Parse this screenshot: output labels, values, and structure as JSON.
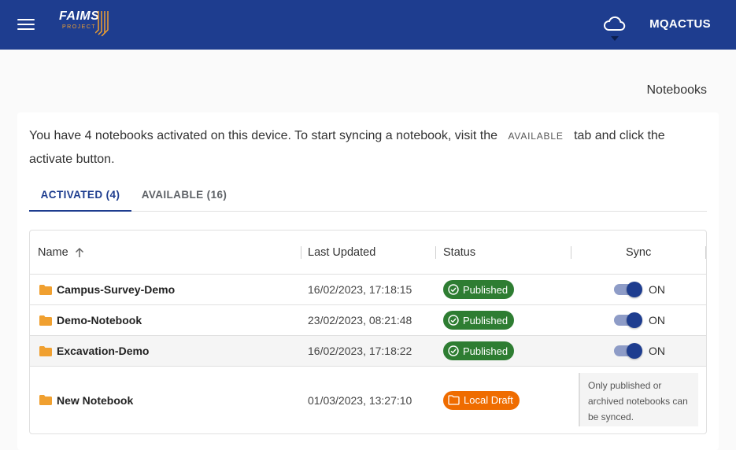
{
  "appbar": {
    "logo_text": "FAIMS",
    "logo_sub": "PROJECT",
    "user": "MQACTUS",
    "colors": {
      "bar": "#1e3d8f",
      "accent": "#f0a030"
    }
  },
  "page": {
    "title": "Notebooks"
  },
  "intro": {
    "before": "You have 4 notebooks activated on this device. To start syncing a notebook, visit the",
    "code": "AVAILABLE",
    "after": "tab and click the activate button."
  },
  "tabs": [
    {
      "label": "ACTIVATED (4)",
      "selected": true
    },
    {
      "label": "AVAILABLE (16)",
      "selected": false
    }
  ],
  "table": {
    "columns": {
      "name": "Name",
      "last_updated": "Last Updated",
      "status": "Status",
      "sync": "Sync"
    },
    "rows": [
      {
        "name": "Campus-Survey-Demo",
        "last_updated": "16/02/2023, 17:18:15",
        "status": "Published",
        "sync": "ON"
      },
      {
        "name": "Demo-Notebook",
        "last_updated": "23/02/2023, 08:21:48",
        "status": "Published",
        "sync": "ON"
      },
      {
        "name": "Excavation-Demo",
        "last_updated": "16/02/2023, 17:18:22",
        "status": "Published",
        "sync": "ON"
      },
      {
        "name": "New Notebook",
        "last_updated": "01/03/2023, 13:27:10",
        "status": "Local Draft",
        "sync_note": "Only published or archived notebooks can be synced."
      }
    ]
  }
}
